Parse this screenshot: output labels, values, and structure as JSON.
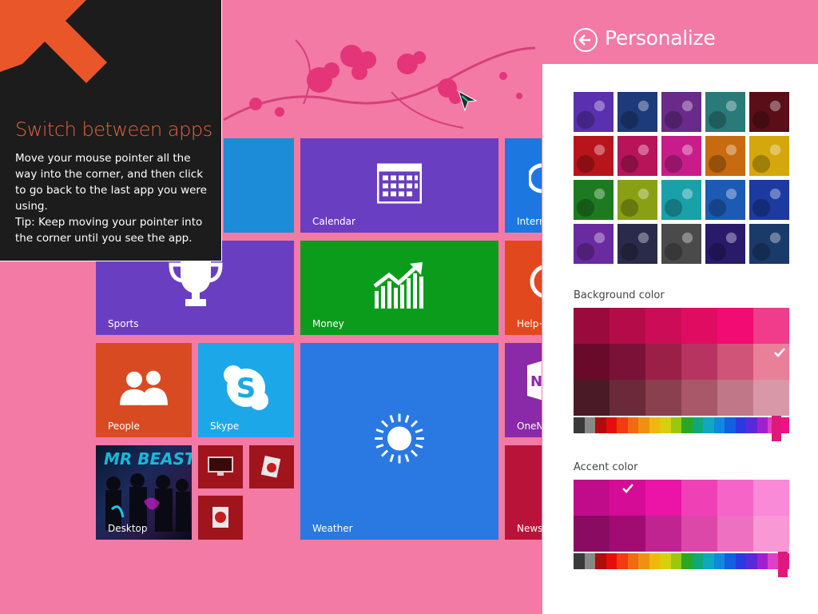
{
  "tooltip": {
    "title": "Switch between apps",
    "body": "Move your mouse pointer all the way into the corner, and then click to go back to the last app you were using.",
    "tip": "Tip: Keep moving your pointer into the corner until you see the app."
  },
  "tiles": {
    "calendar": "Calendar",
    "internet": "Intern",
    "sports": "Sports",
    "money": "Money",
    "help": "Help+",
    "people": "People",
    "skype": "Skype",
    "weather": "Weather",
    "onenote": "OneN",
    "desktop": "Desktop",
    "news": "News"
  },
  "personalize": {
    "title": "Personalize",
    "back_icon": "back-arrow-icon",
    "patterns": [
      "#5a2fb0",
      "#1d3a7a",
      "#6a2a8a",
      "#2a7a7a",
      "#5a0f18",
      "#b8141c",
      "#b8145a",
      "#c81c8a",
      "#c86a10",
      "#d4a80c",
      "#1e7a20",
      "#8aa014",
      "#1aa0a8",
      "#1c5ab4",
      "#1c3aa0",
      "#6a2aa0",
      "#2a2a4a",
      "#4a4a4a",
      "#2a1a6a",
      "#1a3a6a"
    ],
    "background_label": "Background color",
    "background_colors": [
      [
        "#9a0a3c",
        "#b40c48",
        "#cc0c56",
        "#e00c62",
        "#f00c72",
        "#f03c8a"
      ],
      [
        "#6a0a2a",
        "#7a1238",
        "#9a2048",
        "#b83460",
        "#d05478",
        "#e8809a"
      ],
      [
        "#4a1a26",
        "#6a2a3a",
        "#8a404e",
        "#a85868",
        "#c07888",
        "#d898a8"
      ]
    ],
    "background_selected": [
      1,
      5
    ],
    "accent_label": "Accent color",
    "accent_colors": [
      [
        "#c00c8a",
        "#d40c96",
        "#ec14a6",
        "#f040b6",
        "#f664c8",
        "#f88ad8"
      ],
      [
        "#8a0c62",
        "#a00c72",
        "#c02490",
        "#dc48a8",
        "#ee70c0",
        "#f898d4"
      ]
    ],
    "accent_selected": [
      0,
      1
    ],
    "hue_colors": [
      "#3a3a3a",
      "#888888",
      "#b00c0c",
      "#e80c0c",
      "#f03c10",
      "#f06a10",
      "#f09010",
      "#f0b80c",
      "#d8d00c",
      "#9ac80c",
      "#2aa820",
      "#10a878",
      "#10a8c0",
      "#1088e0",
      "#1060e0",
      "#2a3ae0",
      "#5a2ad8",
      "#a020d0",
      "#e040c8",
      "#f0108a"
    ],
    "background_hue_value": 0.94,
    "accent_hue_value": 0.97
  }
}
